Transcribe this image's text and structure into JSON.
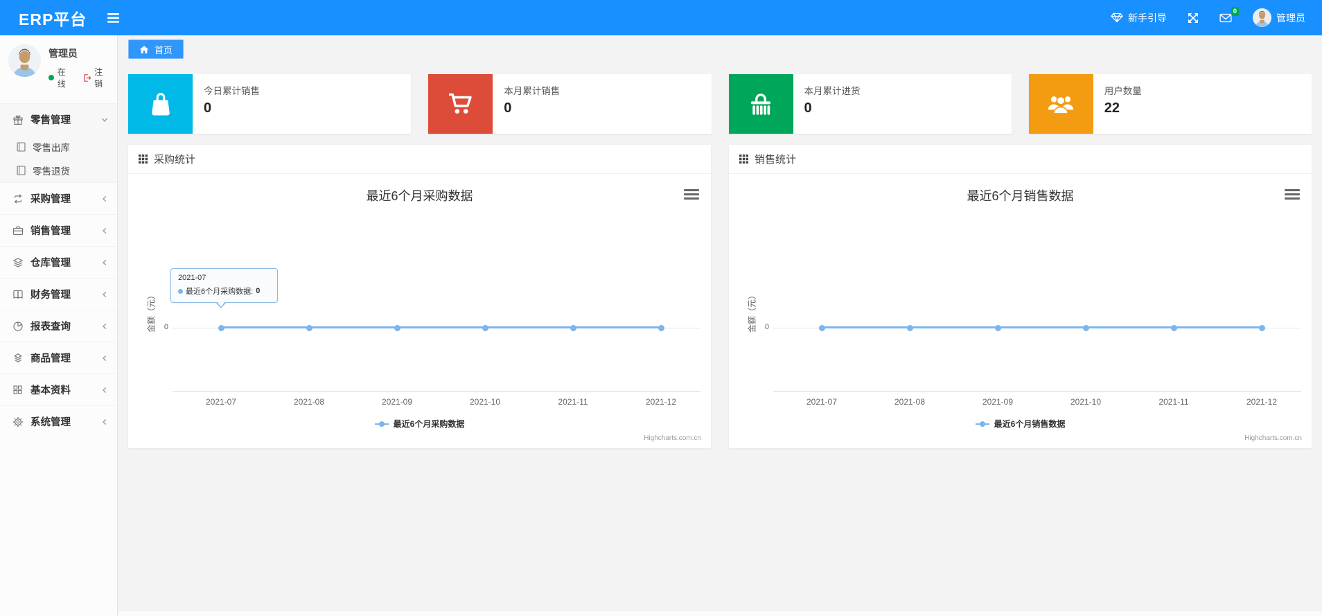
{
  "navbar": {
    "brand": "ERP平台",
    "guide_label": "新手引导",
    "mail_badge": "0",
    "user_name": "管理员"
  },
  "sidebar": {
    "user_name": "管理员",
    "status_online": "在线",
    "logout_label": "注销",
    "items": [
      {
        "label": "零售管理",
        "icon": "gift-icon",
        "state": "expanded",
        "children": [
          {
            "label": "零售出库",
            "icon": "journal-icon"
          },
          {
            "label": "零售退货",
            "icon": "journal-icon"
          }
        ]
      },
      {
        "label": "采购管理",
        "icon": "repeat-icon"
      },
      {
        "label": "销售管理",
        "icon": "briefcase-icon"
      },
      {
        "label": "仓库管理",
        "icon": "layers-icon"
      },
      {
        "label": "财务管理",
        "icon": "open-book-icon"
      },
      {
        "label": "报表查询",
        "icon": "pie-chart-icon"
      },
      {
        "label": "商品管理",
        "icon": "box-icon"
      },
      {
        "label": "基本资料",
        "icon": "grid-icon"
      },
      {
        "label": "系统管理",
        "icon": "gear-icon"
      }
    ]
  },
  "breadcrumb": {
    "home_label": "首页"
  },
  "cards": [
    {
      "title": "今日累计销售",
      "value": "0",
      "color": "#00b9e6",
      "icon": "shopping-bag-icon"
    },
    {
      "title": "本月累计销售",
      "value": "0",
      "color": "#dd4b39",
      "icon": "cart-icon"
    },
    {
      "title": "本月累计进货",
      "value": "0",
      "color": "#00a65a",
      "icon": "basket-icon"
    },
    {
      "title": "用户数量",
      "value": "22",
      "color": "#f39c12",
      "icon": "users-icon"
    }
  ],
  "chart_data": [
    {
      "type": "line",
      "panel_header": "采购统计",
      "title": "最近6个月采购数据",
      "categories": [
        "2021-07",
        "2021-08",
        "2021-09",
        "2021-10",
        "2021-11",
        "2021-12"
      ],
      "series": [
        {
          "name": "最近6个月采购数据",
          "values": [
            0,
            0,
            0,
            0,
            0,
            0
          ]
        }
      ],
      "ylabel": "金额（元）",
      "y_tick": "0",
      "ylim": [
        0,
        0
      ],
      "grid": "off",
      "legend": "最近6个月采购数据",
      "legend_position": "bottom",
      "line_color": "#7cb5ec",
      "watermark": "Highcharts.com.cn",
      "tooltip": {
        "header": "2021-07",
        "label": "最近6个月采购数据: ",
        "value": "0"
      }
    },
    {
      "type": "line",
      "panel_header": "销售统计",
      "title": "最近6个月销售数据",
      "categories": [
        "2021-07",
        "2021-08",
        "2021-09",
        "2021-10",
        "2021-11",
        "2021-12"
      ],
      "series": [
        {
          "name": "最近6个月销售数据",
          "values": [
            0,
            0,
            0,
            0,
            0,
            0
          ]
        }
      ],
      "ylabel": "金额（元）",
      "y_tick": "0",
      "ylim": [
        0,
        0
      ],
      "grid": "off",
      "legend": "最近6个月销售数据",
      "legend_position": "bottom",
      "line_color": "#7cb5ec",
      "watermark": "Highcharts.com.cn"
    }
  ]
}
